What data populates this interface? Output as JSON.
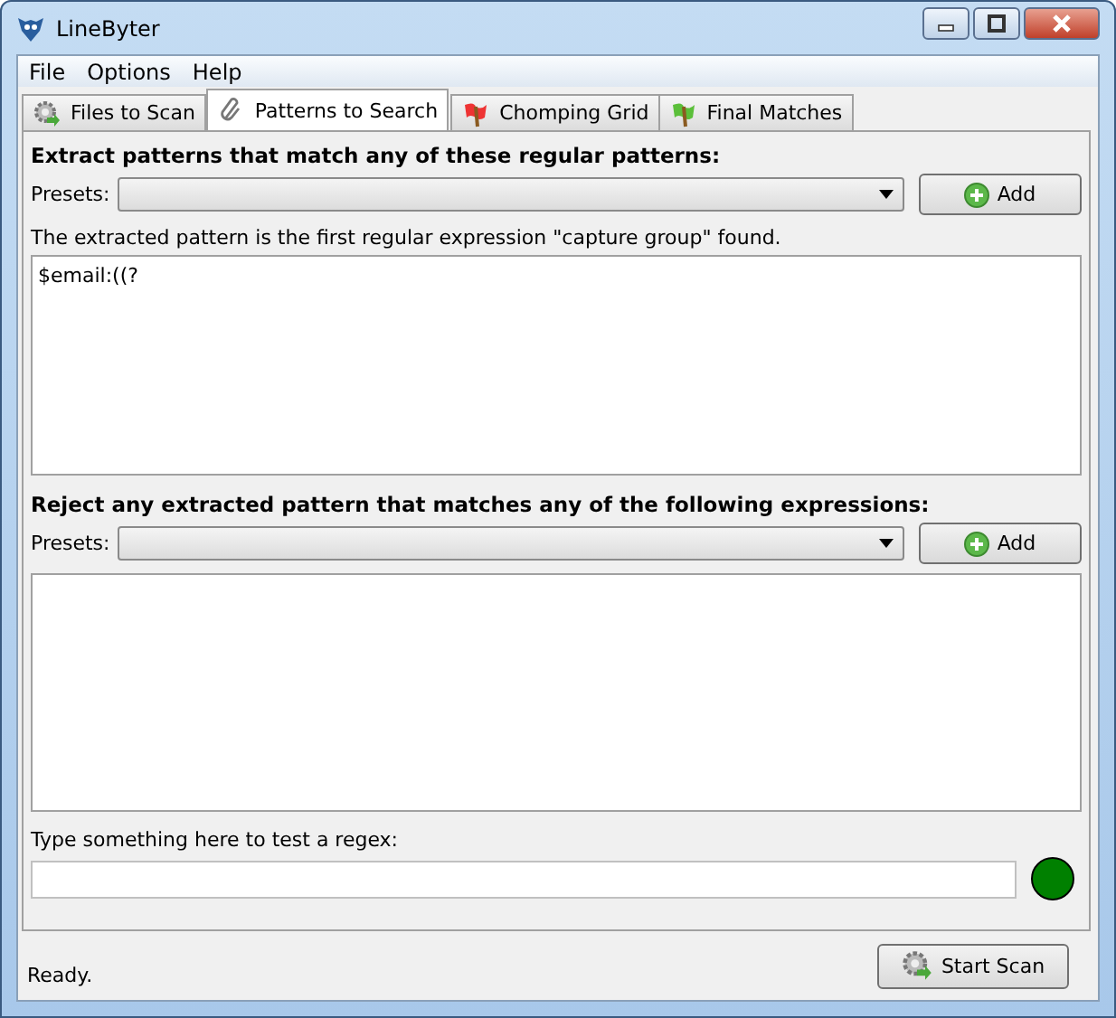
{
  "window": {
    "title": "LineByter"
  },
  "menu": [
    "File",
    "Options",
    "Help"
  ],
  "tabs": [
    {
      "label": "Files to Scan",
      "kind": "gear",
      "selected": false
    },
    {
      "label": "Patterns to Search",
      "kind": "clip",
      "selected": true
    },
    {
      "label": "Chomping Grid",
      "kind": "redflag",
      "selected": false
    },
    {
      "label": "Final Matches",
      "kind": "greenflag",
      "selected": false
    }
  ],
  "extract": {
    "heading": "Extract patterns that match any of these regular patterns:",
    "presets_label": "Presets:",
    "add_button": "Add",
    "note": "The extracted pattern is the first regular expression \"capture group\" found.",
    "patterns": "$email:((?"
  },
  "reject": {
    "heading": "Reject any extracted pattern that matches any of the following expressions:",
    "presets_label": "Presets:",
    "add_button": "Add"
  },
  "test": {
    "label": "Type something here to test a regex:",
    "matched": true
  },
  "status_bar": {
    "text": "Ready.",
    "start_button": "Start Scan"
  }
}
